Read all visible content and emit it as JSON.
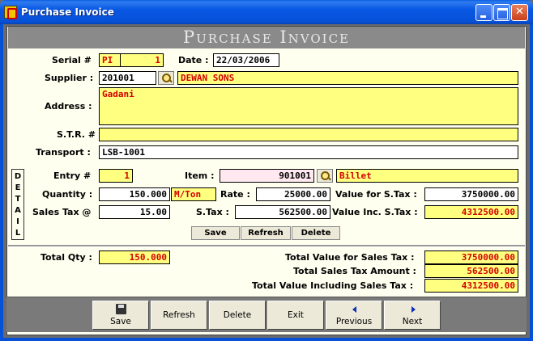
{
  "window": {
    "title": "Purchase Invoice"
  },
  "banner": "Purchase Invoice",
  "header": {
    "serial_label": "Serial #",
    "serial_prefix": "PI",
    "serial_number": "1",
    "date_label": "Date :",
    "date_value": "22/03/2006",
    "supplier_label": "Supplier :",
    "supplier_code": "201001",
    "supplier_name": "DEWAN SONS",
    "address_label": "Address :",
    "address_value": "Gadani",
    "str_label": "S.T.R. #",
    "str_value": "",
    "transport_label": "Transport :",
    "transport_value": "LSB-1001"
  },
  "detail": {
    "tab_letters": [
      "D",
      "E",
      "T",
      "A",
      "I",
      "L"
    ],
    "entry_label": "Entry #",
    "entry_value": "1",
    "item_label": "Item :",
    "item_code": "901001",
    "item_name": "Billet",
    "quantity_label": "Quantity :",
    "quantity_value": "150.000",
    "unit": "M/Ton",
    "rate_label": "Rate :",
    "rate_value": "25000.00",
    "value_stax_label": "Value for S.Tax :",
    "value_stax": "3750000.00",
    "salestax_label": "Sales Tax @",
    "salestax_rate": "15.00",
    "stax_label": "S.Tax :",
    "stax_value": "562500.00",
    "value_inc_label": "Value Inc. S.Tax :",
    "value_inc": "4312500.00",
    "save_label": "Save",
    "refresh_label": "Refresh",
    "delete_label": "Delete"
  },
  "totals": {
    "qty_label": "Total Qty :",
    "qty_value": "150.000",
    "value_label": "Total Value for Sales Tax :",
    "value_value": "3750000.00",
    "tax_label": "Total Sales Tax Amount :",
    "tax_value": "562500.00",
    "incl_label": "Total Value Including Sales Tax :",
    "incl_value": "4312500.00"
  },
  "toolbar": {
    "save": "Save",
    "refresh": "Refresh",
    "delete": "Delete",
    "exit": "Exit",
    "previous": "Previous",
    "next": "Next"
  }
}
